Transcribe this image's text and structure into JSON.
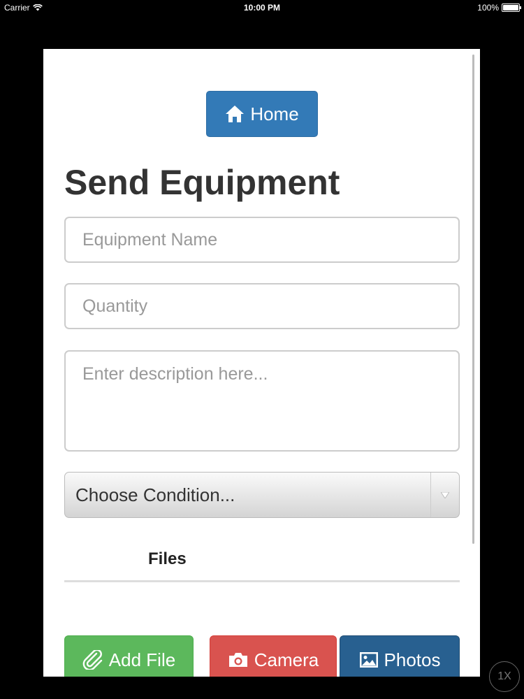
{
  "status_bar": {
    "carrier": "Carrier",
    "time": "10:00 PM",
    "battery": "100%"
  },
  "header": {
    "home_label": "Home"
  },
  "form": {
    "title": "Send Equipment",
    "equipment_name_placeholder": "Equipment Name",
    "quantity_placeholder": "Quantity",
    "description_placeholder": "Enter description here...",
    "condition_selected": "Choose Condition..."
  },
  "files": {
    "label": "Files"
  },
  "actions": {
    "add_file_label": "Add File",
    "camera_label": "Camera",
    "photos_label": "Photos"
  },
  "overlay": {
    "zoom_label": "1X"
  },
  "icons": {
    "home": "home-icon",
    "paperclip": "paperclip-icon",
    "camera": "camera-icon",
    "photo": "photo-icon",
    "wifi": "wifi-icon",
    "battery": "battery-icon",
    "dropdown": "triangle-down-icon"
  },
  "colors": {
    "primary": "#337ab7",
    "success": "#5cb85c",
    "danger": "#d9534f",
    "dark_primary": "#286090"
  }
}
